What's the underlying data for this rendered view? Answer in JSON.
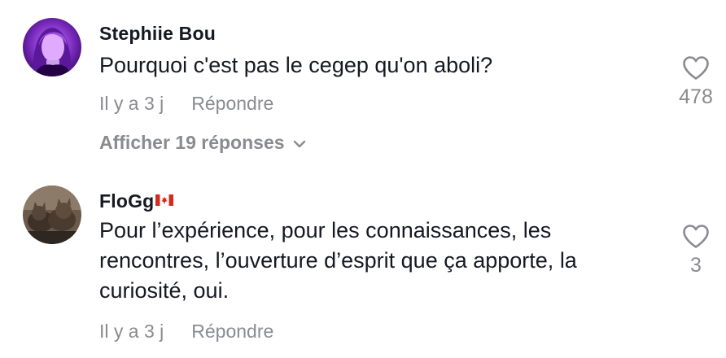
{
  "comments": [
    {
      "username": "Stephiie Bou",
      "text": "Pourquoi c'est pas le cegep qu'on aboli?",
      "timestamp": "Il y a 3 j",
      "reply_label": "Répondre",
      "like_count": "478",
      "view_replies_label": "Afficher 19 réponses",
      "avatar_icon": "avatar-purple-portrait"
    },
    {
      "username": "FloGg",
      "username_flag": "canada-flag",
      "text": "Pour l’expérience, pour les connaissances, les rencontres, l’ouverture d’esprit que ça apporte, la curiosité, oui.",
      "timestamp": "Il y a 3 j",
      "reply_label": "Répondre",
      "like_count": "3",
      "avatar_icon": "avatar-cats"
    }
  ],
  "colors": {
    "text": "#161823",
    "muted": "#8a8b91",
    "flag_red": "#d52b1e"
  }
}
